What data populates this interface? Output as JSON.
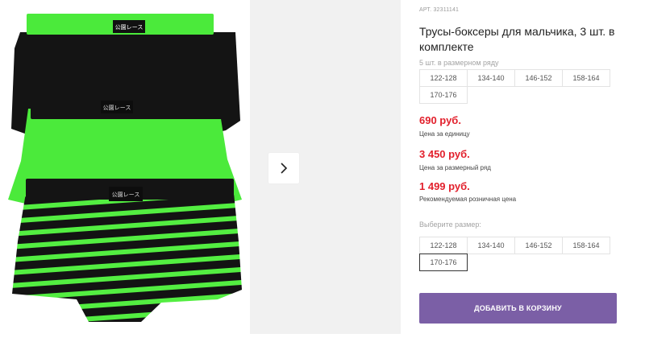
{
  "product": {
    "sku_label": "АРТ.",
    "sku_value": "32311141",
    "title": "Трусы-боксеры для мальчика, 3 шт. в комплекте",
    "set_caption": "5 шт. в размерном ряду",
    "set_sizes": [
      "122-128",
      "134-140",
      "146-152",
      "158-164",
      "170-176"
    ],
    "prices": [
      {
        "amount": "690 руб.",
        "note": "Цена за единицу"
      },
      {
        "amount": "3 450 руб.",
        "note": "Цена за размерный ряд"
      },
      {
        "amount": "1 499 руб.",
        "note": "Рекомендуемая розничная цена"
      }
    ],
    "choose_label": "Выберите размер:",
    "sizes": [
      "122-128",
      "134-140",
      "146-152",
      "158-164",
      "170-176"
    ],
    "selected_size": "170-176",
    "cart_button": "ДОБАВИТЬ В КОРЗИНУ"
  },
  "gallery": {
    "next_icon": "chevron-right-icon",
    "brand_tag": "公園レース"
  },
  "colors": {
    "price": "#e2202c",
    "cart_button": "#7b5fa6",
    "neon_green": "#4bea3b",
    "black": "#141414"
  }
}
